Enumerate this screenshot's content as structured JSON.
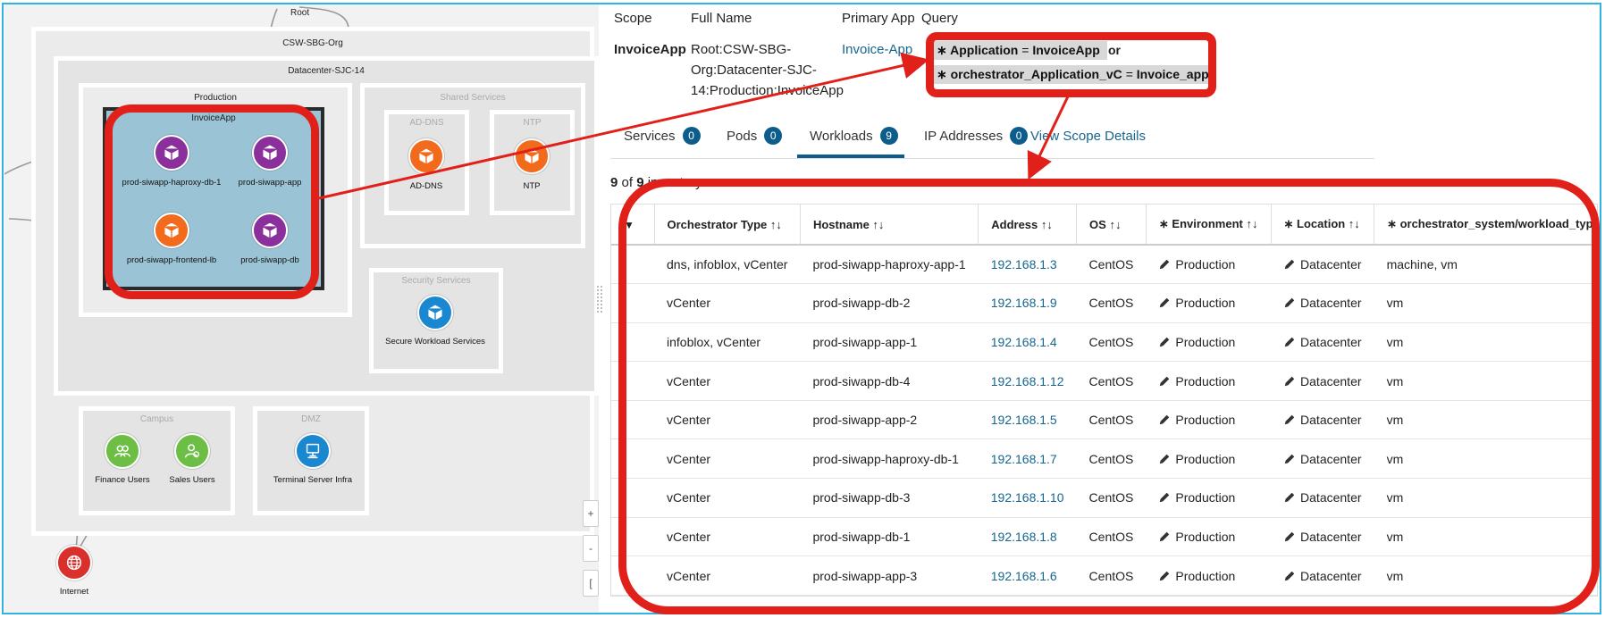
{
  "map": {
    "root_label": "Root",
    "org_label": "CSW-SBG-Org",
    "dc_label": "Datacenter-SJC-14",
    "production_label": "Production",
    "invoiceapp_label": "InvoiceApp",
    "shared_label": "Shared Services",
    "addns_scope_label": "AD-DNS",
    "ntp_scope_label": "NTP",
    "security_label": "Security Services",
    "campus_label": "Campus",
    "dmz_label": "DMZ",
    "nodes": {
      "haproxy_db": "prod-siwapp-haproxy-db-1",
      "siwapp_app": "prod-siwapp-app",
      "frontend_lb": "prod-siwapp-frontend-lb",
      "siwapp_db": "prod-siwapp-db",
      "ad_dns": "AD-DNS",
      "ntp": "NTP",
      "secure_workload": "Secure Workload Services",
      "finance_users": "Finance Users",
      "sales_users": "Sales Users",
      "terminal_server": "Terminal Server Infra",
      "internet": "Internet"
    },
    "zoom_plus": "+",
    "zoom_minus": "-",
    "fit": "["
  },
  "details": {
    "headers": {
      "scope": "Scope",
      "full_name": "Full Name",
      "primary_app": "Primary App",
      "query": "Query"
    },
    "scope": "InvoiceApp",
    "full_name_lines": [
      "Root:CSW-SBG-",
      "Org:Datacenter-SJC-",
      "14:Production:InvoiceApp"
    ],
    "primary_app": "Invoice-App",
    "query": {
      "q1_key": "Application",
      "q1_val": "InvoiceApp",
      "operator": "or",
      "q2_key": "orchestrator_Application_vC",
      "q2_val": "Invoice_app"
    }
  },
  "tabs": [
    {
      "label": "Services",
      "count": "0"
    },
    {
      "label": "Pods",
      "count": "0"
    },
    {
      "label": "Workloads",
      "count": "9"
    },
    {
      "label": "IP Addresses",
      "count": "0"
    }
  ],
  "view_scope_link": "View Scope Details",
  "inventory_count": {
    "shown": "9",
    "of": "of",
    "total": "9",
    "suffix": "inventory"
  },
  "table": {
    "columns": [
      "Orchestrator Type ↑↓",
      "Hostname ↑↓",
      "Address ↑↓",
      "OS ↑↓",
      "∗ Environment ↑↓",
      "∗ Location ↑↓",
      "∗ orchestrator_system/workload_type"
    ],
    "rows": [
      [
        "dns, infoblox, vCenter",
        "prod-siwapp-haproxy-app-1",
        "192.168.1.3",
        "CentOS",
        "Production",
        "Datacenter",
        "machine, vm"
      ],
      [
        "vCenter",
        "prod-siwapp-db-2",
        "192.168.1.9",
        "CentOS",
        "Production",
        "Datacenter",
        "vm"
      ],
      [
        "infoblox, vCenter",
        "prod-siwapp-app-1",
        "192.168.1.4",
        "CentOS",
        "Production",
        "Datacenter",
        "vm"
      ],
      [
        "vCenter",
        "prod-siwapp-db-4",
        "192.168.1.12",
        "CentOS",
        "Production",
        "Datacenter",
        "vm"
      ],
      [
        "vCenter",
        "prod-siwapp-app-2",
        "192.168.1.5",
        "CentOS",
        "Production",
        "Datacenter",
        "vm"
      ],
      [
        "vCenter",
        "prod-siwapp-haproxy-db-1",
        "192.168.1.7",
        "CentOS",
        "Production",
        "Datacenter",
        "vm"
      ],
      [
        "vCenter",
        "prod-siwapp-db-3",
        "192.168.1.10",
        "CentOS",
        "Production",
        "Datacenter",
        "vm"
      ],
      [
        "vCenter",
        "prod-siwapp-db-1",
        "192.168.1.8",
        "CentOS",
        "Production",
        "Datacenter",
        "vm"
      ],
      [
        "vCenter",
        "prod-siwapp-app-3",
        "192.168.1.6",
        "CentOS",
        "Production",
        "Datacenter",
        "vm"
      ]
    ]
  },
  "colors": {
    "highlight": "#e1201a",
    "accent": "#0d5d8c",
    "link": "#17658f",
    "frame": "#2fb3e0"
  }
}
